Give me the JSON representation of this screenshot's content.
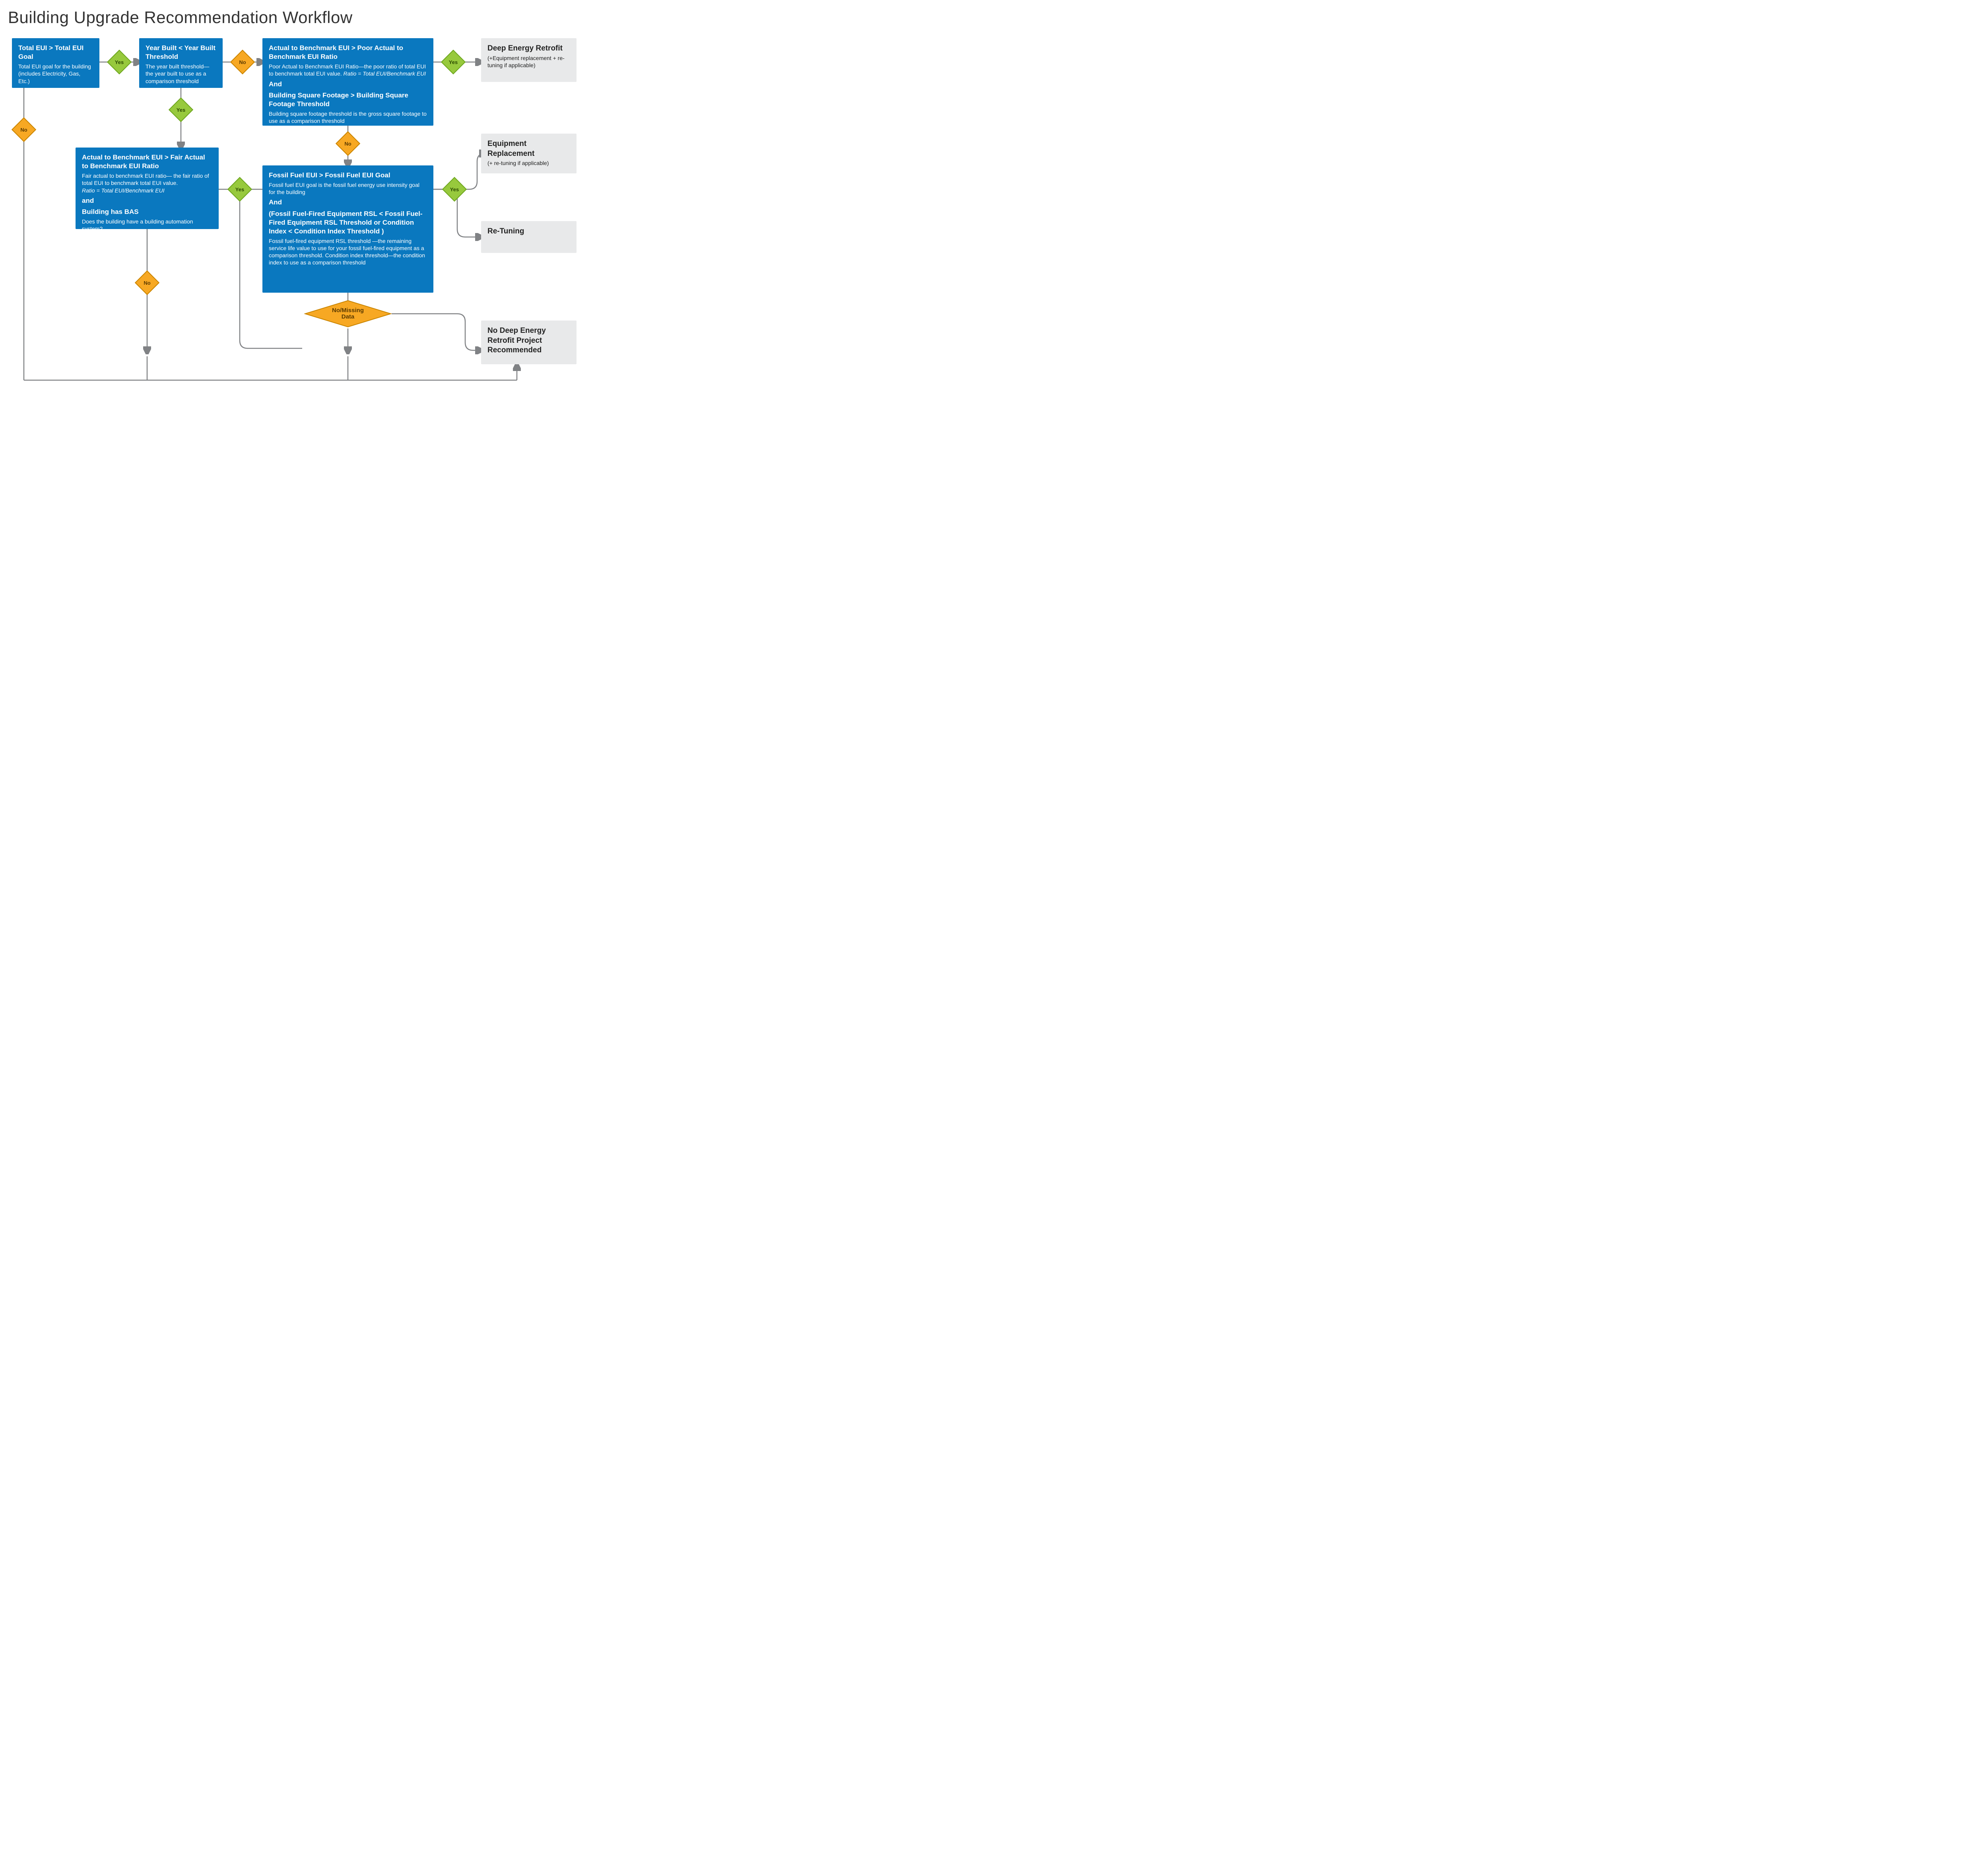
{
  "title": "Building Upgrade Recommendation Workflow",
  "labels": {
    "yes": "Yes",
    "no": "No",
    "no_missing": "No/Missing\nData"
  },
  "nodes": {
    "n1": {
      "title": "Total EUI > Total EUI Goal",
      "desc": "Total EUI goal for the building (includes Electricity, Gas, Etc.)"
    },
    "n2": {
      "title": "Year Built < Year Built Threshold",
      "desc": "The year built threshold— the year built to use as a comparison threshold"
    },
    "n3": {
      "title1": "Actual to Benchmark EUI > Poor Actual to Benchmark EUI Ratio",
      "desc1_a": "Poor Actual to Benchmark EUI Ratio—the poor ratio of total EUI to benchmark total EUI value. ",
      "desc1_b": "Ratio = Total EUI/Benchmark EUI",
      "and": "And",
      "title2": "Building Square Footage  > Building Square Footage Threshold",
      "desc2": "Building square footage threshold is the gross square footage to use as a comparison threshold"
    },
    "n4": {
      "title1": "Actual to Benchmark EUI  > Fair Actual to Benchmark EUI Ratio",
      "desc1_a": "Fair actual to benchmark EUI ratio— the fair ratio of total EUI to benchmark total EUI value.",
      "desc1_b": "Ratio = Total EUI/Benchmark EUI",
      "and": "and",
      "title2": "Building has BAS",
      "desc2": "Does the building have a building automation system?"
    },
    "n5": {
      "title1": "Fossil Fuel EUI > Fossil Fuel EUI Goal",
      "desc1": "Fossil fuel EUI goal is the fossil fuel energy use intensity goal for the building",
      "and": "And",
      "title2": "(Fossil Fuel-Fired Equipment RSL < Fossil Fuel-Fired Equipment RSL Threshold or Condition Index <  Condition Index Threshold )",
      "desc2": "Fossil fuel-fired equipment RSL threshold —the remaining service life value to use for your fossil fuel-fired equipment as a comparison threshold. Condition index threshold—the condition index to use as a comparison threshold"
    }
  },
  "results": {
    "r1": {
      "title": "Deep Energy Retrofit",
      "desc": "(+Equipment replacement + re-tuning if applicable)"
    },
    "r2": {
      "title": "Equipment Replacement",
      "desc": "(+ re-tuning if applicable)"
    },
    "r3": {
      "title": "Re-Tuning",
      "desc": ""
    },
    "r4": {
      "title": "No Deep Energy Retrofit Project Recommended",
      "desc": ""
    }
  }
}
